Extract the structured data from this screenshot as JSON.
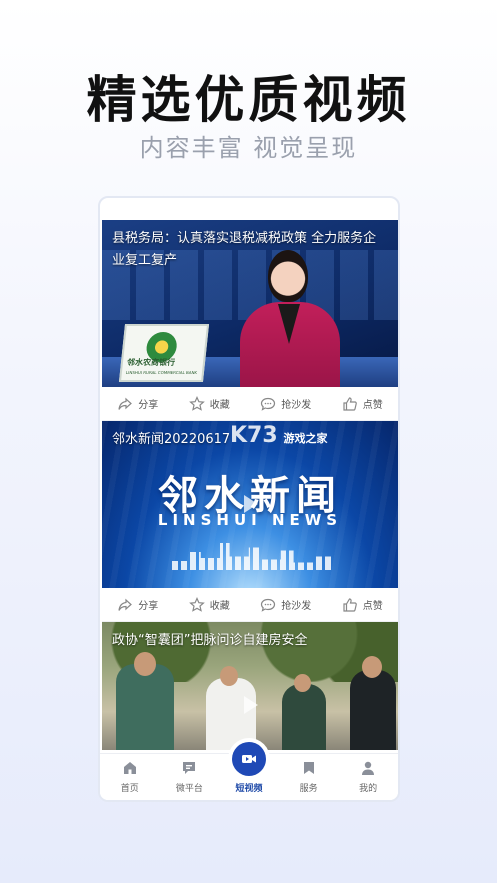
{
  "promo": {
    "headline": "精选优质视频",
    "subheadline": "内容丰富 视觉呈现"
  },
  "feed": {
    "videos": [
      {
        "title": "县税务局：认真落实退税减税政策 全力服务企业复工复产",
        "overlay_text": "邻水农商银行",
        "overlay_subtext": "LINSHUI RURAL COMMERCIAL BANK"
      },
      {
        "title": "邻水新闻20220617",
        "brand_cn": "邻水新闻",
        "brand_en": "LINSHUI NEWS"
      },
      {
        "title": "政协“智囊团”把脉问诊自建房安全"
      }
    ],
    "actions": {
      "share": "分享",
      "favorite": "收藏",
      "comment": "抢沙发",
      "like": "点赞"
    }
  },
  "watermark": {
    "logo": "K73",
    "text": "游戏之家"
  },
  "tabbar": {
    "home": "首页",
    "micro_platform": "微平台",
    "short_video": "短视频",
    "services": "服务",
    "mine": "我的"
  },
  "colors": {
    "accent": "#1f49b6",
    "headline": "#111111",
    "subheadline": "#9aa0ad"
  }
}
